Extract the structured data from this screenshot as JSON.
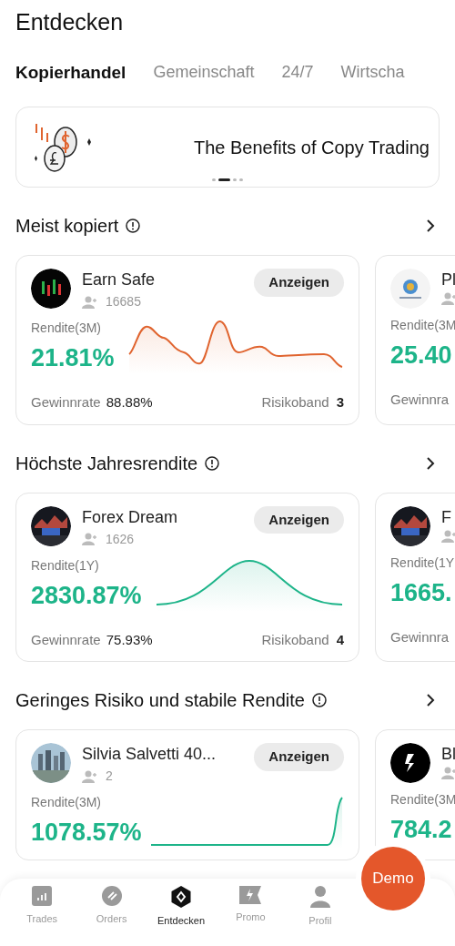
{
  "title": "Entdecken",
  "tabs": [
    {
      "label": "Kopierhandel",
      "selected": true
    },
    {
      "label": "Gemeinschaft",
      "selected": false
    },
    {
      "label": "24/7",
      "selected": false
    },
    {
      "label": "Wirtscha",
      "selected": false
    }
  ],
  "banner": {
    "title": "The Benefits of Copy Trading",
    "slides": [
      {
        "selected": false
      },
      {
        "selected": true
      },
      {
        "selected": false
      },
      {
        "selected": false
      }
    ]
  },
  "sections": [
    {
      "title": "Meist kopiert",
      "cards": [
        {
          "name": "Earn Safe",
          "followers": "16685",
          "action": "Anzeigen",
          "return_label": "Rendite(3M)",
          "return_value": "21.81%",
          "kind": "wavy",
          "color": "#e0642f",
          "win_label": "Gewinnrate",
          "win_value": "88.88%",
          "risk_label": "Risikoband",
          "risk_value": "3"
        },
        {
          "name": "Pl",
          "return_label": "Rendite(3M",
          "return_value": "25.40",
          "win_label": "Gewinnra"
        }
      ]
    },
    {
      "title": "Höchste Jahresrendite",
      "cards": [
        {
          "name": "Forex Dream",
          "followers": "1626",
          "action": "Anzeigen",
          "return_label": "Rendite(1Y)",
          "return_value": "2830.87%",
          "kind": "bell",
          "color": "#1db489",
          "win_label": "Gewinnrate",
          "win_value": "75.93%",
          "risk_label": "Risikoband",
          "risk_value": "4"
        },
        {
          "name": "F",
          "return_label": "Rendite(1Y",
          "return_value": "1665.",
          "win_label": "Gewinnra"
        }
      ]
    },
    {
      "title": "Geringes Risiko und stabile Rendite",
      "cards": [
        {
          "name": "Silvia  Salvetti 40...",
          "followers": "2",
          "action": "Anzeigen",
          "return_label": "Rendite(3M)",
          "return_value": "1078.57%",
          "kind": "spike",
          "color": "#1db489"
        },
        {
          "name": "Bl",
          "return_label": "Rendite(3M",
          "return_value": "784.2"
        }
      ]
    }
  ],
  "nav": [
    {
      "label": "Trades",
      "kind": "chart",
      "selected": false
    },
    {
      "label": "Orders",
      "kind": "orders",
      "selected": false
    },
    {
      "label": "Entdecken",
      "kind": "discover",
      "selected": true
    },
    {
      "label": "Promo",
      "kind": "promo",
      "selected": false
    },
    {
      "label": "Profil",
      "kind": "person",
      "selected": false
    }
  ],
  "demo_button": "Demo"
}
